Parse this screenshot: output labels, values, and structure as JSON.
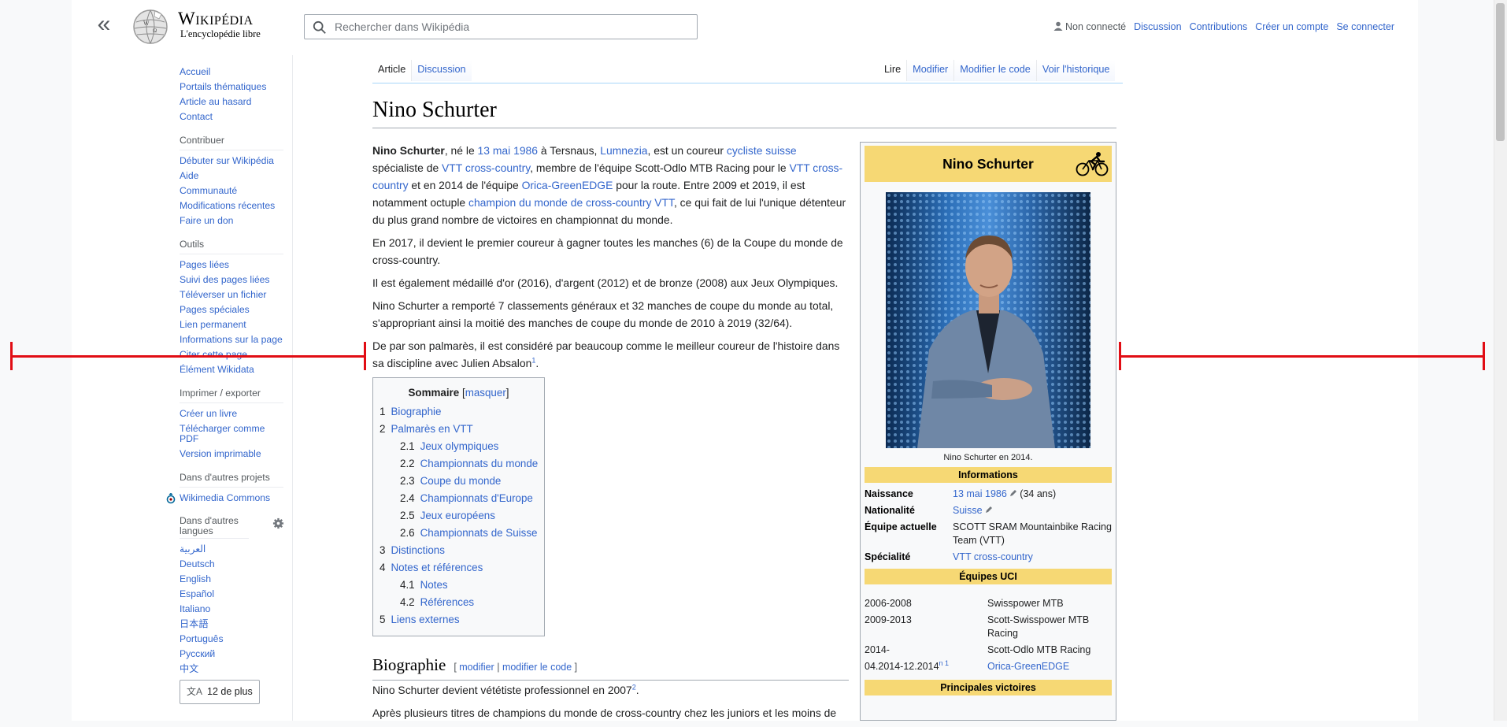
{
  "header": {
    "logo_title": "Wikipédia",
    "logo_tagline": "L'encyclopédie libre",
    "search_placeholder": "Rechercher dans Wikipédia",
    "user_links": {
      "not_connected": "Non connecté",
      "discussion": "Discussion",
      "contributions": "Contributions",
      "create_account": "Créer un compte",
      "login": "Se connecter"
    }
  },
  "sidebar": {
    "nav": [
      "Accueil",
      "Portails thématiques",
      "Article au hasard",
      "Contact"
    ],
    "contribute_heading": "Contribuer",
    "contribute": [
      "Débuter sur Wikipédia",
      "Aide",
      "Communauté",
      "Modifications récentes",
      "Faire un don"
    ],
    "tools_heading": "Outils",
    "tools": [
      "Pages liées",
      "Suivi des pages liées",
      "Téléverser un fichier",
      "Pages spéciales",
      "Lien permanent",
      "Informations sur la page",
      "Citer cette page",
      "Élément Wikidata"
    ],
    "print_heading": "Imprimer / exporter",
    "print": [
      "Créer un livre",
      "Télécharger comme PDF",
      "Version imprimable"
    ],
    "projects_heading": "Dans d'autres projets",
    "projects": [
      "Wikimedia Commons"
    ],
    "languages_heading": "Dans d'autres langues",
    "languages": [
      "العربية",
      "Deutsch",
      "English",
      "Español",
      "Italiano",
      "日本語",
      "Português",
      "Русский",
      "中文"
    ],
    "more_languages": "12 de plus"
  },
  "tabs": {
    "left": [
      "Article",
      "Discussion"
    ],
    "right": [
      "Lire",
      "Modifier",
      "Modifier le code",
      "Voir l'historique"
    ]
  },
  "article": {
    "title": "Nino Schurter",
    "p1": {
      "name": "Nino Schurter",
      "t1": ", né le ",
      "date": "13 mai 1986",
      "t2": " à Tersnaus, ",
      "place": "Lumnezia",
      "t3": ", est un coureur ",
      "cyclist": "cycliste suisse",
      "t4": " spécialiste de ",
      "vtt1": "VTT cross-country",
      "t5": ", membre de l'équipe Scott-Odlo MTB Racing pour le ",
      "vtt2": "VTT cross-country",
      "t6": " et en 2014 de l'équipe ",
      "orica": "Orica-GreenEDGE",
      "t7": " pour la route. Entre 2009 et 2019, il est notamment octuple ",
      "champion": "champion du monde de cross-country VTT",
      "t8": ", ce qui fait de lui l'unique détenteur du plus grand nombre de victoires en championnat du monde."
    },
    "p2": "En 2017, il devient le premier coureur à gagner toutes les manches (6) de la Coupe du monde de cross-country.",
    "p3": "Il est également médaillé d'or (2016), d'argent (2012) et de bronze (2008) aux Jeux Olympiques.",
    "p4": "Nino Schurter a remporté 7 classements généraux et 32 manches de coupe du monde au total, s'appropriant ainsi la moitié des manches de coupe du monde de 2010 à 2019 (32/64).",
    "p5_text": "De par son palmarès, il est considéré par beaucoup comme le meilleur coureur de l'histoire dans sa discipline avec Julien Absalon",
    "p5_ref": "1",
    "p5_end": "."
  },
  "toc": {
    "title": "Sommaire",
    "toggle": "masquer",
    "items": [
      {
        "num": "1",
        "label": "Biographie",
        "level": 1
      },
      {
        "num": "2",
        "label": "Palmarès en VTT",
        "level": 1
      },
      {
        "num": "2.1",
        "label": "Jeux olympiques",
        "level": 2
      },
      {
        "num": "2.2",
        "label": "Championnats du monde",
        "level": 2
      },
      {
        "num": "2.3",
        "label": "Coupe du monde",
        "level": 2
      },
      {
        "num": "2.4",
        "label": "Championnats d'Europe",
        "level": 2
      },
      {
        "num": "2.5",
        "label": "Jeux européens",
        "level": 2
      },
      {
        "num": "2.6",
        "label": "Championnats de Suisse",
        "level": 2
      },
      {
        "num": "3",
        "label": "Distinctions",
        "level": 1
      },
      {
        "num": "4",
        "label": "Notes et références",
        "level": 1
      },
      {
        "num": "4.1",
        "label": "Notes",
        "level": 2
      },
      {
        "num": "4.2",
        "label": "Références",
        "level": 2
      },
      {
        "num": "5",
        "label": "Liens externes",
        "level": 1
      }
    ]
  },
  "section": {
    "title": "Biographie",
    "edit": "modifier",
    "edit_code": "modifier le code",
    "p1_text": "Nino Schurter devient vététiste professionnel en 2007",
    "p1_ref": "2",
    "p1_end": ".",
    "p2": "Après plusieurs titres de champions du monde de cross-country chez les juniors et les moins de"
  },
  "infobox": {
    "title": "Nino Schurter",
    "caption": "Nino Schurter en 2014.",
    "info_heading": "Informations",
    "rows": {
      "birth_label": "Naissance",
      "birth_value": "13 mai 1986",
      "birth_age": "(34 ans)",
      "nationality_label": "Nationalité",
      "nationality_value": "Suisse",
      "team_label": "Équipe actuelle",
      "team_value": "SCOTT SRAM Mountainbike Racing Team (VTT)",
      "specialty_label": "Spécialité",
      "specialty_value": "VTT cross-country"
    },
    "uci_heading": "Équipes UCI",
    "teams": [
      {
        "years": "2006-2008",
        "team": "Swisspower MTB",
        "link": false
      },
      {
        "years": "2009-2013",
        "team": "Scott-Swisspower MTB Racing",
        "link": false
      },
      {
        "years": "2014-",
        "team": "Scott-Odlo MTB Racing",
        "link": false
      },
      {
        "years": "04.2014-12.2014",
        "years_ref": "n 1",
        "team": "Orica-GreenEDGE",
        "link": true
      }
    ],
    "victories_heading": "Principales victoires"
  },
  "colors": {
    "link": "#3366cc",
    "infobox_header": "#f6d874",
    "annotation_red": "#e10d14"
  }
}
